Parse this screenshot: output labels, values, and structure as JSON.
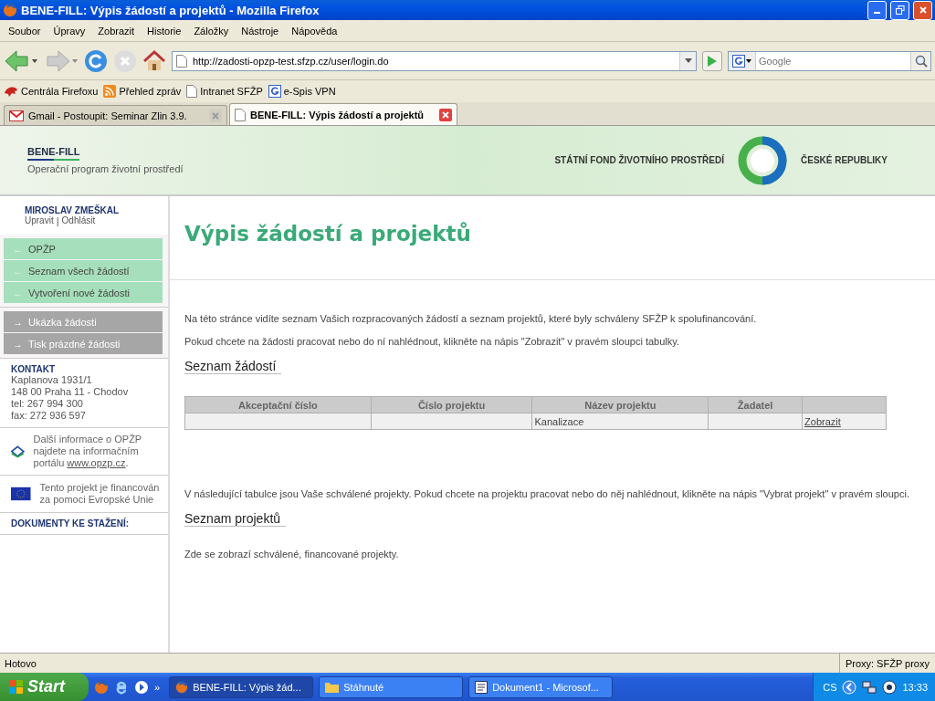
{
  "window": {
    "title": "BENE-FILL: Výpis žádostí a projektů - Mozilla Firefox"
  },
  "menu": [
    "Soubor",
    "Úpravy",
    "Zobrazit",
    "Historie",
    "Záložky",
    "Nástroje",
    "Nápověda"
  ],
  "toolbar": {
    "url": "http://zadosti-opzp-test.sfzp.cz/user/login.do",
    "search_placeholder": "Google"
  },
  "bookmarks": [
    {
      "label": "Centrála Firefoxu",
      "kind": "fox"
    },
    {
      "label": "Přehled zpráv",
      "kind": "rss"
    },
    {
      "label": "Intranet SFŽP",
      "kind": "page"
    },
    {
      "label": "e-Spis VPN",
      "kind": "google"
    }
  ],
  "tabs": [
    {
      "label": "Gmail - Postoupit: Seminar Zlin 3.9.",
      "kind": "mail",
      "selected": false
    },
    {
      "label": "BENE-FILL: Výpis žádostí a projektů",
      "kind": "page",
      "selected": true
    }
  ],
  "header": {
    "brand": "BENE-FILL",
    "subtitle": "Operační program životní prostředí",
    "fund": "STÁTNÍ FOND ŽIVOTNÍHO PROSTŘEDÍ",
    "country": "ČESKÉ REPUBLIKY"
  },
  "sidebar": {
    "user": "MIROSLAV ZMEŠKAL",
    "user_links": [
      "Upravit",
      "Odhlásit"
    ],
    "link_separator": "|",
    "nav": [
      {
        "arrow": "←",
        "label": "OPŽP",
        "kind": "green"
      },
      {
        "arrow": "←",
        "label": "Seznam všech žádostí",
        "kind": "green"
      },
      {
        "arrow": "←",
        "label": "Vytvoření nové žádosti",
        "kind": "green"
      }
    ],
    "docs": [
      {
        "arrow": "→",
        "label": "Ukázka žádosti",
        "kind": "gray"
      },
      {
        "arrow": "→",
        "label": "Tisk prázdné žádosti",
        "kind": "gray"
      }
    ],
    "contact": {
      "title": "KONTAKT",
      "lines": [
        "Kaplanova 1931/1",
        "148 00 Praha 11 - Chodov",
        "tel: 267 994 300",
        "fax: 272 936 597"
      ]
    },
    "opzp_info": {
      "text": "Další informace o OPŽP najdete na informačním portálu",
      "link": "www.opzp.cz",
      "tail": "."
    },
    "eu_info": "Tento projekt je financován za pomoci Evropské Unie",
    "downloads": "DOKUMENTY KE STAŽENÍ:"
  },
  "main": {
    "title": "Výpis žádostí a projektů",
    "intro": [
      "Na této stránce vidíte seznam Vašich rozpracovaných žádostí a seznam projektů, které byly schváleny SFŽP k spolufinancování.",
      "Pokud chcete na žádosti pracovat nebo do ní nahlédnout, klikněte na nápis \"Zobrazit\" v pravém sloupci tabulky."
    ],
    "requests": {
      "title": "Seznam žádostí",
      "columns": [
        "Akceptační číslo",
        "Číslo projektu",
        "Název projektu",
        "Žadatel",
        ""
      ],
      "rows": [
        {
          "cells": [
            "",
            "",
            "Kanalizace",
            ""
          ],
          "action": "Zobrazit"
        }
      ]
    },
    "projects_intro": "V následující tabulce jsou Vaše schválené projekty. Pokud chcete na projektu pracovat nebo do něj nahlédnout, klikněte na nápis \"Vybrat projekt\" v pravém sloupci.",
    "projects": {
      "title": "Seznam projektů",
      "empty": "Zde se zobrazí schválené, financované projekty."
    }
  },
  "status_bar": {
    "left": "Hotovo",
    "right": "Proxy: SFŽP proxy"
  },
  "taskbar": {
    "start": "Start",
    "more": "»",
    "tasks": [
      {
        "label": "BENE-FILL: Výpis žád...",
        "kind": "firefox",
        "selected": true
      },
      {
        "label": "Stáhnuté",
        "kind": "folder",
        "selected": false
      },
      {
        "label": "Dokument1 - Microsof...",
        "kind": "word",
        "selected": false
      }
    ],
    "lang": "CS",
    "clock": "13:33"
  }
}
